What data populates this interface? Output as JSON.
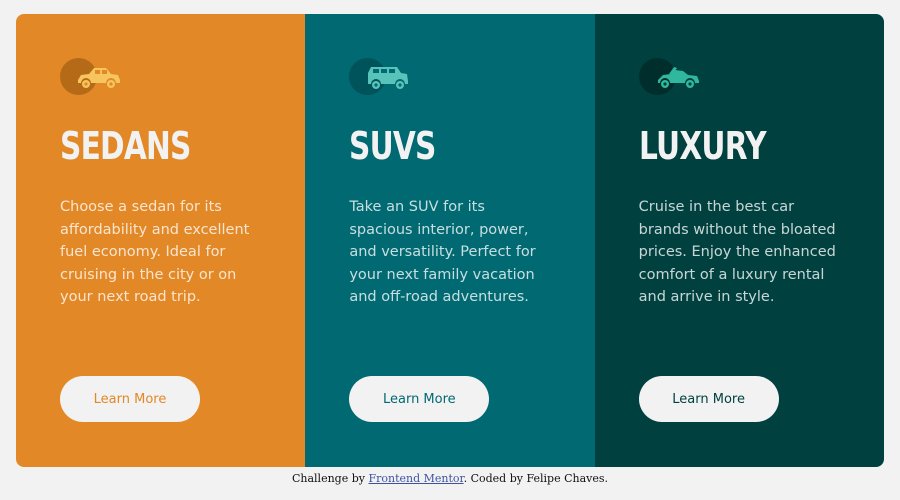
{
  "cards": [
    {
      "icon": "sedan-car-icon",
      "title": "Sedans",
      "text": "Choose a sedan for its affordability and excellent fuel economy. Ideal for cruising in the city or on your next road trip.",
      "button": "Learn More",
      "color": "#e38826"
    },
    {
      "icon": "suv-car-icon",
      "title": "SUVs",
      "text": "Take an SUV for its spacious interior, power, and versatility. Perfect for your next family vacation and off-road adventures.",
      "button": "Learn More",
      "color": "#006971"
    },
    {
      "icon": "luxury-car-icon",
      "title": "Luxury",
      "text": "Cruise in the best car brands without the bloated prices. Enjoy the enhanced comfort of a luxury rental and arrive in style.",
      "button": "Learn More",
      "color": "#004140"
    }
  ],
  "attribution": {
    "prefix": "Challenge by ",
    "link": "Frontend Mentor",
    "suffix": ". Coded by Felipe Chaves."
  },
  "colors": {
    "background": "#f2f2f2",
    "icon_fill_sedan": "#f6c55d",
    "icon_fill_suv": "#58c3b8",
    "icon_fill_luxury": "#2fb89e"
  }
}
